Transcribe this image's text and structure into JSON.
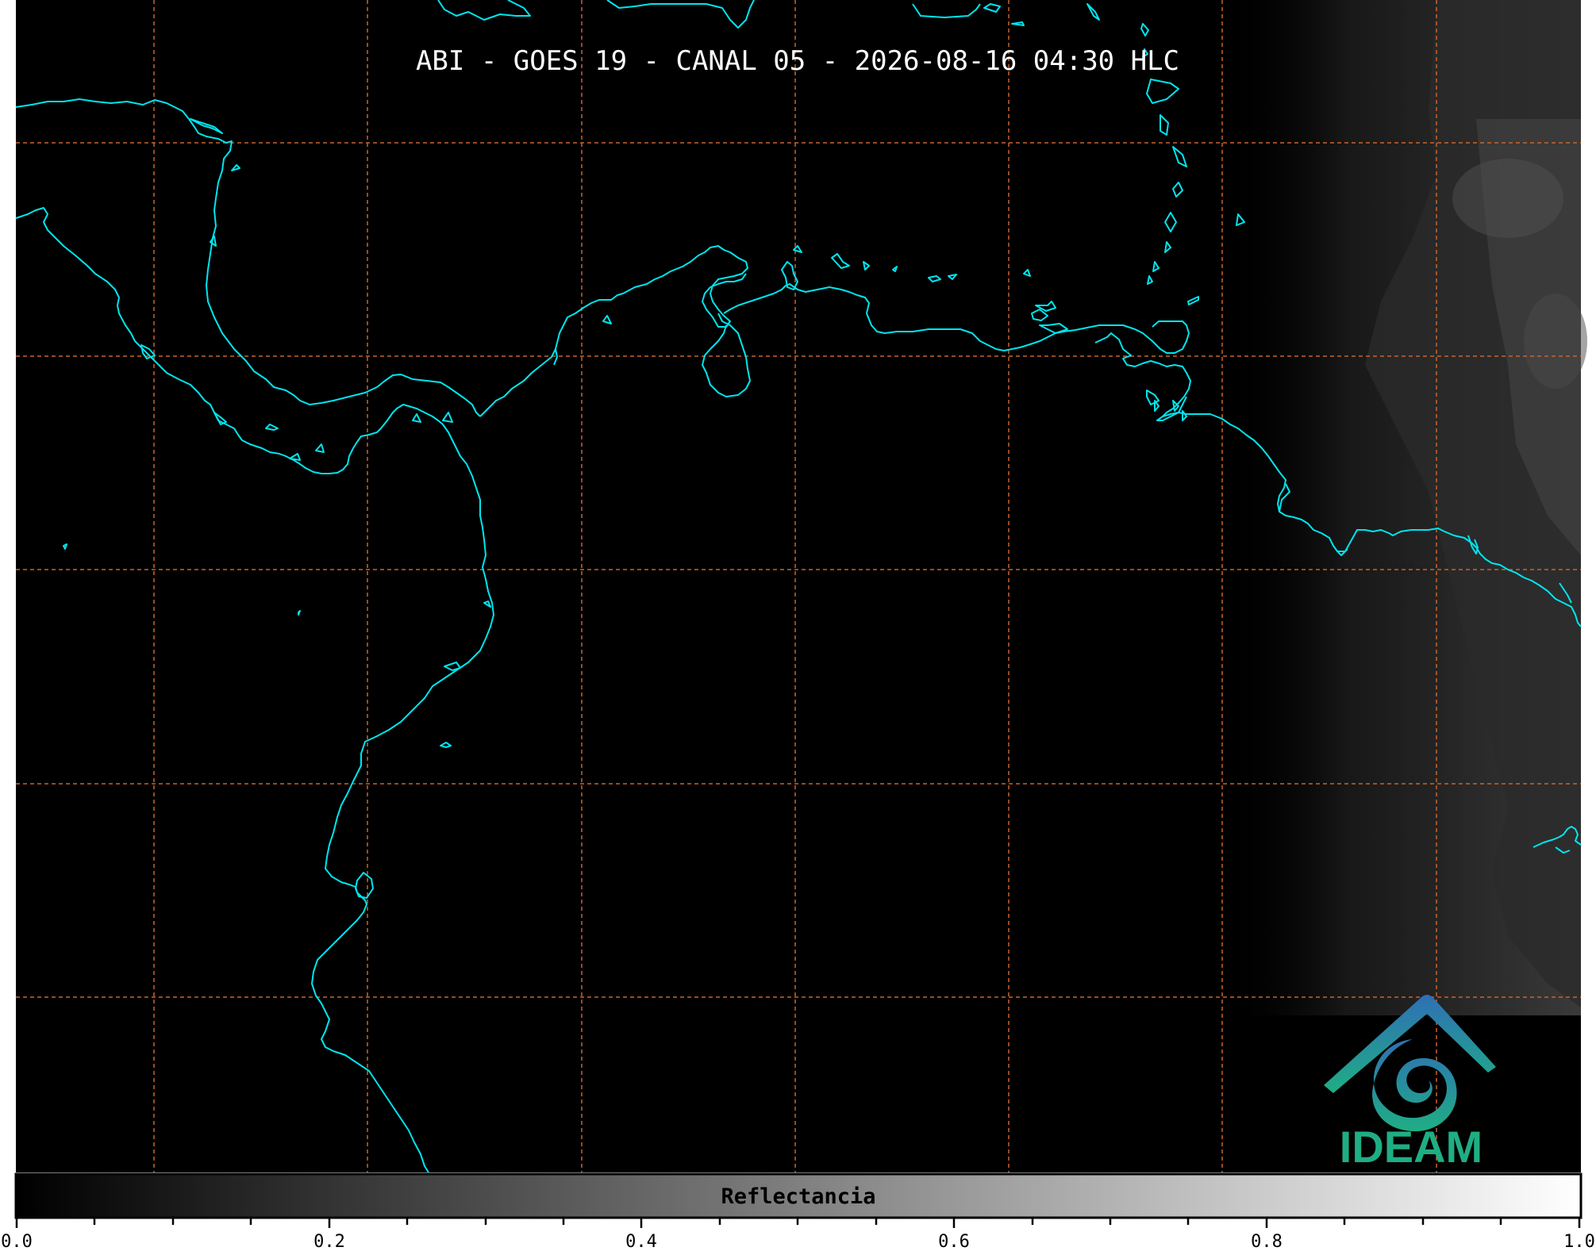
{
  "map": {
    "title": "ABI - GOES 19 - CANAL 05 - 2026-08-16 04:30 HLC",
    "colors": {
      "background": "#000000",
      "coastline": "#00e5ee",
      "gridline": "#c8642a",
      "cloud": "#5a5a5a"
    }
  },
  "colorbar": {
    "label": "Reflectancia",
    "ticks": [
      "0.0",
      "0.2",
      "0.4",
      "0.6",
      "0.8",
      "1.0"
    ],
    "range": [
      0.0,
      1.0
    ],
    "gradient": [
      "#000000",
      "#ffffff"
    ]
  },
  "logo": {
    "text": "IDEAM",
    "colors": [
      "#2f7fb5",
      "#1fae84"
    ]
  }
}
